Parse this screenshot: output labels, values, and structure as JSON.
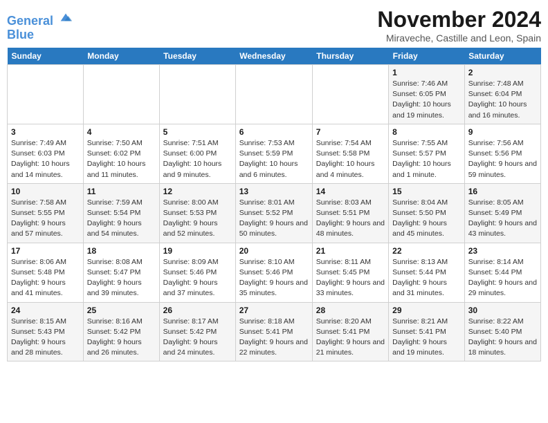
{
  "logo": {
    "line1": "General",
    "line2": "Blue"
  },
  "title": "November 2024",
  "subtitle": "Miraveche, Castille and Leon, Spain",
  "days_of_week": [
    "Sunday",
    "Monday",
    "Tuesday",
    "Wednesday",
    "Thursday",
    "Friday",
    "Saturday"
  ],
  "weeks": [
    [
      {
        "day": "",
        "info": ""
      },
      {
        "day": "",
        "info": ""
      },
      {
        "day": "",
        "info": ""
      },
      {
        "day": "",
        "info": ""
      },
      {
        "day": "",
        "info": ""
      },
      {
        "day": "1",
        "info": "Sunrise: 7:46 AM\nSunset: 6:05 PM\nDaylight: 10 hours and 19 minutes."
      },
      {
        "day": "2",
        "info": "Sunrise: 7:48 AM\nSunset: 6:04 PM\nDaylight: 10 hours and 16 minutes."
      }
    ],
    [
      {
        "day": "3",
        "info": "Sunrise: 7:49 AM\nSunset: 6:03 PM\nDaylight: 10 hours and 14 minutes."
      },
      {
        "day": "4",
        "info": "Sunrise: 7:50 AM\nSunset: 6:02 PM\nDaylight: 10 hours and 11 minutes."
      },
      {
        "day": "5",
        "info": "Sunrise: 7:51 AM\nSunset: 6:00 PM\nDaylight: 10 hours and 9 minutes."
      },
      {
        "day": "6",
        "info": "Sunrise: 7:53 AM\nSunset: 5:59 PM\nDaylight: 10 hours and 6 minutes."
      },
      {
        "day": "7",
        "info": "Sunrise: 7:54 AM\nSunset: 5:58 PM\nDaylight: 10 hours and 4 minutes."
      },
      {
        "day": "8",
        "info": "Sunrise: 7:55 AM\nSunset: 5:57 PM\nDaylight: 10 hours and 1 minute."
      },
      {
        "day": "9",
        "info": "Sunrise: 7:56 AM\nSunset: 5:56 PM\nDaylight: 9 hours and 59 minutes."
      }
    ],
    [
      {
        "day": "10",
        "info": "Sunrise: 7:58 AM\nSunset: 5:55 PM\nDaylight: 9 hours and 57 minutes."
      },
      {
        "day": "11",
        "info": "Sunrise: 7:59 AM\nSunset: 5:54 PM\nDaylight: 9 hours and 54 minutes."
      },
      {
        "day": "12",
        "info": "Sunrise: 8:00 AM\nSunset: 5:53 PM\nDaylight: 9 hours and 52 minutes."
      },
      {
        "day": "13",
        "info": "Sunrise: 8:01 AM\nSunset: 5:52 PM\nDaylight: 9 hours and 50 minutes."
      },
      {
        "day": "14",
        "info": "Sunrise: 8:03 AM\nSunset: 5:51 PM\nDaylight: 9 hours and 48 minutes."
      },
      {
        "day": "15",
        "info": "Sunrise: 8:04 AM\nSunset: 5:50 PM\nDaylight: 9 hours and 45 minutes."
      },
      {
        "day": "16",
        "info": "Sunrise: 8:05 AM\nSunset: 5:49 PM\nDaylight: 9 hours and 43 minutes."
      }
    ],
    [
      {
        "day": "17",
        "info": "Sunrise: 8:06 AM\nSunset: 5:48 PM\nDaylight: 9 hours and 41 minutes."
      },
      {
        "day": "18",
        "info": "Sunrise: 8:08 AM\nSunset: 5:47 PM\nDaylight: 9 hours and 39 minutes."
      },
      {
        "day": "19",
        "info": "Sunrise: 8:09 AM\nSunset: 5:46 PM\nDaylight: 9 hours and 37 minutes."
      },
      {
        "day": "20",
        "info": "Sunrise: 8:10 AM\nSunset: 5:46 PM\nDaylight: 9 hours and 35 minutes."
      },
      {
        "day": "21",
        "info": "Sunrise: 8:11 AM\nSunset: 5:45 PM\nDaylight: 9 hours and 33 minutes."
      },
      {
        "day": "22",
        "info": "Sunrise: 8:13 AM\nSunset: 5:44 PM\nDaylight: 9 hours and 31 minutes."
      },
      {
        "day": "23",
        "info": "Sunrise: 8:14 AM\nSunset: 5:44 PM\nDaylight: 9 hours and 29 minutes."
      }
    ],
    [
      {
        "day": "24",
        "info": "Sunrise: 8:15 AM\nSunset: 5:43 PM\nDaylight: 9 hours and 28 minutes."
      },
      {
        "day": "25",
        "info": "Sunrise: 8:16 AM\nSunset: 5:42 PM\nDaylight: 9 hours and 26 minutes."
      },
      {
        "day": "26",
        "info": "Sunrise: 8:17 AM\nSunset: 5:42 PM\nDaylight: 9 hours and 24 minutes."
      },
      {
        "day": "27",
        "info": "Sunrise: 8:18 AM\nSunset: 5:41 PM\nDaylight: 9 hours and 22 minutes."
      },
      {
        "day": "28",
        "info": "Sunrise: 8:20 AM\nSunset: 5:41 PM\nDaylight: 9 hours and 21 minutes."
      },
      {
        "day": "29",
        "info": "Sunrise: 8:21 AM\nSunset: 5:41 PM\nDaylight: 9 hours and 19 minutes."
      },
      {
        "day": "30",
        "info": "Sunrise: 8:22 AM\nSunset: 5:40 PM\nDaylight: 9 hours and 18 minutes."
      }
    ]
  ]
}
